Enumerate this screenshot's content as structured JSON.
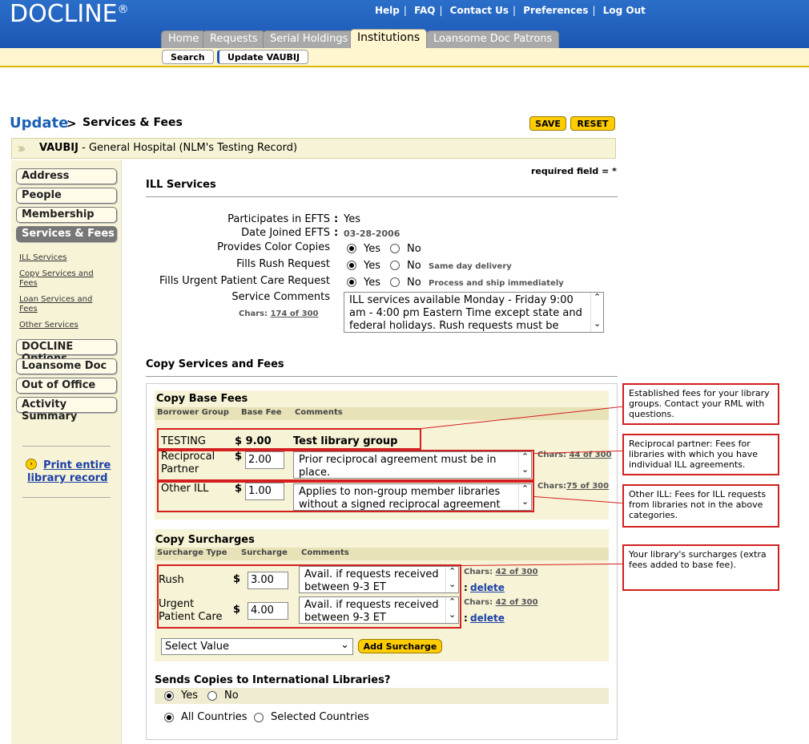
{
  "header": {
    "logo": "DOCLINE",
    "logo_mark": "®",
    "util_links": [
      "Help",
      "FAQ",
      "Contact Us",
      "Preferences",
      "Log Out"
    ],
    "tabs": [
      "Home",
      "Requests",
      "Serial Holdings",
      "Institutions",
      "Loansome Doc Patrons"
    ],
    "active_tab": "Institutions",
    "subtabs": [
      "Search",
      "Update VAUBIJ"
    ]
  },
  "page": {
    "breadcrumb_root": "Update",
    "breadcrumb_sep": ">",
    "section": "Services & Fees",
    "save_label": "SAVE",
    "reset_label": "RESET",
    "record_id": "VAUBIJ",
    "record_name": " - General Hospital (NLM's Testing Record)",
    "required_note": "required field = *"
  },
  "sidebar": {
    "buttons": [
      "Address",
      "People",
      "Membership",
      "Services & Fees",
      "DOCLINE Options",
      "Loansome Doc",
      "Out of Office",
      "Activity Summary"
    ],
    "sublinks": [
      "ILL Services",
      "Copy Services and Fees",
      "Loan Services and Fees",
      "Other Services"
    ],
    "print_link": "Print entire library record"
  },
  "ill": {
    "title": "ILL Services",
    "efts_label": "Participates in EFTS",
    "efts_value": "Yes",
    "date_label": "Date Joined EFTS",
    "date_value": "03-28-2006",
    "color_label": "Provides Color Copies",
    "rush_label": "Fills Rush Request",
    "rush_note": "Same day delivery",
    "urgent_label": "Fills Urgent Patient Care Request",
    "urgent_note": "Process and ship immediately",
    "comments_label": "Service Comments",
    "chars_label": "Chars:",
    "chars_value": "174 of 300",
    "comments_value": "ILL services available Monday - Friday 9:00 am - 4:00 pm Eastern Time except state and federal holidays. Rush requests must be",
    "colon": ":",
    "yes": "Yes",
    "no": "No"
  },
  "copy": {
    "title": "Copy Services and Fees",
    "base_title": "Copy Base Fees",
    "col_group": "Borrower Group",
    "col_fee": "Base Fee",
    "col_comments": "Comments",
    "rows": [
      {
        "group": "TESTING",
        "fee": "$ 9.00",
        "comment": "Test library group"
      },
      {
        "group": "Reciprocal Partner",
        "currency": "$",
        "fee": "2.00",
        "comment": "Prior reciprocal agreement must be in place.",
        "chars": "44 of 300"
      },
      {
        "group": "Other ILL",
        "currency": "$",
        "fee": "1.00",
        "comment": "Applies to non-group member libraries without a signed reciprocal agreement",
        "chars": "75 of 300"
      }
    ],
    "sur_title": "Copy Surcharges",
    "col_type": "Surcharge Type",
    "col_surcharge": "Surcharge",
    "surcharges": [
      {
        "type": "Rush",
        "currency": "$",
        "value": "3.00",
        "comment": "Avail. if requests received between 9-3 ET",
        "chars": "42 of 300",
        "delete": "delete"
      },
      {
        "type": "Urgent Patient Care",
        "currency": "$",
        "value": "4.00",
        "comment": "Avail. if requests received between 9-3 ET",
        "chars": "42 of 300",
        "delete": "delete"
      }
    ],
    "delete_prefix": ":",
    "select_value": "Select Value",
    "add_surcharge": "Add Surcharge",
    "intl_title": "Sends Copies to International Libraries?",
    "intl_yes": "Yes",
    "intl_no": "No",
    "all_countries": "All Countries",
    "selected_countries": "Selected Countries"
  },
  "callouts": [
    "Established fees for your library groups.  Contact your RML with questions.",
    "Reciprocal partner: Fees for libraries with which you have individual ILL agreements.",
    "Other ILL: Fees for ILL requests from libraries not in the above categories.",
    "Your library's surcharges (extra fees added to base fee)."
  ]
}
